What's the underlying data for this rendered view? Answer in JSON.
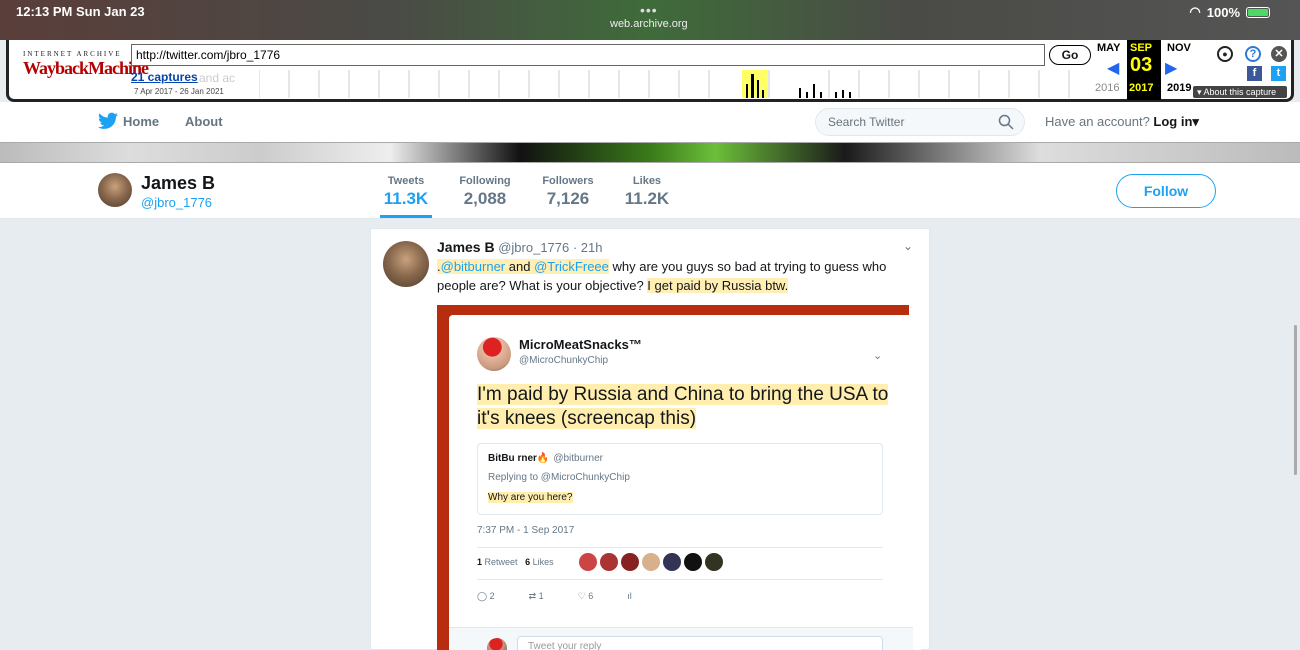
{
  "status_bar": {
    "time_date": "12:13 PM   Sun Jan 23",
    "site": "web.archive.org",
    "battery": "100%"
  },
  "wayback": {
    "logo_top": "INTERNET ARCHIVE",
    "logo_main": "WaybackMachine",
    "url": "http://twitter.com/jbro_1776",
    "go_label": "Go",
    "captures": "21 captures",
    "captures_ghost": "and ac",
    "range": "7 Apr 2017 - 26 Jan 2021",
    "prev_month": "MAY",
    "cur_month": "SEP",
    "next_month": "NOV",
    "prev_year": "2016",
    "cur_year": "2017",
    "next_year": "2019",
    "cur_day": "03",
    "about_capture": "About this capture"
  },
  "twitter_nav": {
    "home": "Home",
    "about": "About",
    "search_placeholder": "Search Twitter",
    "have_account": "Have an account?",
    "login": "Log in"
  },
  "profile": {
    "name": "James B",
    "handle": "@jbro_1776",
    "stats": [
      {
        "label": "Tweets",
        "value": "11.3K"
      },
      {
        "label": "Following",
        "value": "2,088"
      },
      {
        "label": "Followers",
        "value": "7,126"
      },
      {
        "label": "Likes",
        "value": "11.2K"
      }
    ],
    "follow": "Follow"
  },
  "tweet": {
    "name": "James B",
    "meta": "@jbro_1776 · 21h",
    "lead": ".",
    "mention1": "@bitburner",
    "and": " and ",
    "mention2": "@TrickFreee",
    "text1": " why are you guys so bad at trying to guess who people are? What is your objective? ",
    "text2": "I get paid by Russia btw."
  },
  "embedded": {
    "name": "MicroMeatSnacks™",
    "handle": "@MicroChunkyChip",
    "body": "I'm paid by Russia and China to bring the USA to it's knees (screencap this)",
    "quote_name": "BitBu rner🔥",
    "quote_handle": "@bitburner",
    "quote_reply": "Replying to @MicroChunkyChip",
    "quote_text": "Why are you here?",
    "timestamp": "7:37 PM - 1 Sep 2017",
    "retweets": "1",
    "retweet_label": "Retweet",
    "likes": "6",
    "likes_label": "Likes",
    "reply_count": "2",
    "retweet_count": "1",
    "like_count": "6",
    "reply_placeholder": "Tweet your reply"
  }
}
